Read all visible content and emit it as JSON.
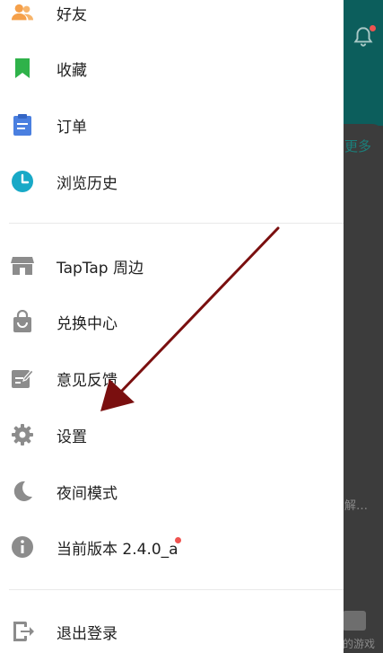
{
  "background": {
    "more_label": "更多",
    "partial_text": "解…",
    "games_label": "的游戏"
  },
  "menu": {
    "items": [
      {
        "label": "好友",
        "icon": "friends-icon",
        "color": "#f5a04a"
      },
      {
        "label": "收藏",
        "icon": "bookmark-icon",
        "color": "#2fb24a"
      },
      {
        "label": "订单",
        "icon": "order-icon",
        "color": "#4a7fe0"
      },
      {
        "label": "浏览历史",
        "icon": "clock-icon",
        "color": "#18a9c7"
      },
      {
        "label": "TapTap 周边",
        "icon": "store-icon",
        "color": "#8c8c8c"
      },
      {
        "label": "兑换中心",
        "icon": "shopping-bag-icon",
        "color": "#8c8c8c"
      },
      {
        "label": "意见反馈",
        "icon": "feedback-edit-icon",
        "color": "#8c8c8c"
      },
      {
        "label": "设置",
        "icon": "gear-icon",
        "color": "#8c8c8c"
      },
      {
        "label": "夜间模式",
        "icon": "moon-icon",
        "color": "#8c8c8c"
      },
      {
        "label": "当前版本 2.4.0_a",
        "icon": "info-icon",
        "color": "#8c8c8c"
      },
      {
        "label": "退出登录",
        "icon": "logout-icon",
        "color": "#8c8c8c"
      }
    ]
  },
  "colors": {
    "accent": "#0c5e5c",
    "badge": "#ef5350",
    "annotation_arrow": "#7a0f0f"
  }
}
